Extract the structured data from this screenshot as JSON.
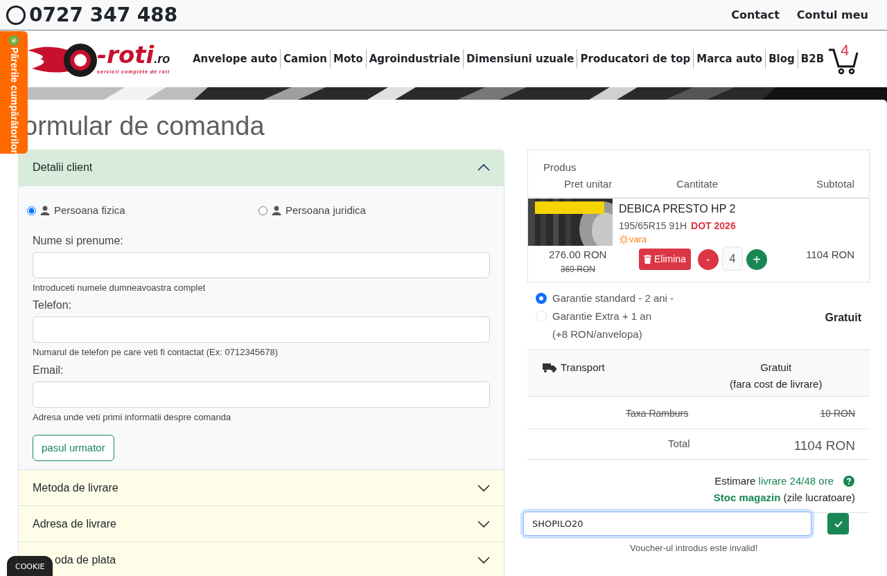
{
  "top_bar": {
    "phone": "0727 347 488",
    "links": [
      "Contact",
      "Contul meu"
    ]
  },
  "reviews_tab": {
    "label": "Părerile cumpărătorilor"
  },
  "logo": {
    "name": "-roti",
    "suffix": ".ro",
    "tagline": "servicii complete de roti"
  },
  "nav": [
    "Anvelope auto",
    "Camion",
    "Moto",
    "Agroindustriale",
    "Dimensiuni uzuale",
    "Producatori de top",
    "Marca auto",
    "Blog",
    "B2B"
  ],
  "cart": {
    "count": "4"
  },
  "page_title": "ormular de comanda",
  "sections": [
    {
      "title": "Detalii client",
      "expanded": true
    },
    {
      "title": "Metoda de livrare",
      "expanded": false
    },
    {
      "title": "Adresa de livrare",
      "expanded": false
    },
    {
      "title": "oda de plata",
      "expanded": false
    }
  ],
  "client_form": {
    "customer_types": [
      {
        "label": "Persoana fizica",
        "selected": true
      },
      {
        "label": "Persoana juridica",
        "selected": false
      }
    ],
    "fields": [
      {
        "label": "Nume si prenume:",
        "help": "Introduceti numele dumneavoastra complet"
      },
      {
        "label": "Telefon:",
        "help": "Numarul de telefon pe care veti fi contactat (Ex: 0712345678)"
      },
      {
        "label": "Email:",
        "help": "Adresa unde veti primi informatii despre comanda"
      }
    ],
    "next_button": "pasul urmator"
  },
  "order": {
    "columns": [
      "Produs",
      "Pret unitar",
      "Cantitate",
      "Subtotal"
    ],
    "items": [
      {
        "name": "DEBICA PRESTO HP 2",
        "size": "195/65R15 91H",
        "dot": "DOT 2026",
        "season": "vara",
        "price": "276.00 RON",
        "old_price": "369 RON",
        "remove": "Elimina",
        "minus": "-",
        "quantity": "4",
        "plus": "+",
        "subtotal": "1104 RON"
      }
    ],
    "warranty": {
      "options": [
        {
          "label": "Garantie standard - 2 ani -",
          "selected": true
        },
        {
          "label": "Garantie Extra + 1 an",
          "note": "(+8 RON/anvelopa)",
          "selected": false
        }
      ],
      "price": "Gratuit"
    },
    "transport": {
      "label": "Transport",
      "value": "Gratuit",
      "note": "(fara cost de livrare)"
    },
    "cod_fee": {
      "label": "Taxa Ramburs",
      "value": "10 RON"
    },
    "total": {
      "label": "Total",
      "value": "1104 RON"
    },
    "estimate": {
      "text": "Estimare",
      "link": "livrare 24/48 ore",
      "stock": "**Stoc magazin** (zile lucratoare)"
    },
    "voucher": {
      "value": "SHOPILO20",
      "message": "Voucher-ul introdus este invalid!"
    }
  },
  "cookie": "COOKIE"
}
